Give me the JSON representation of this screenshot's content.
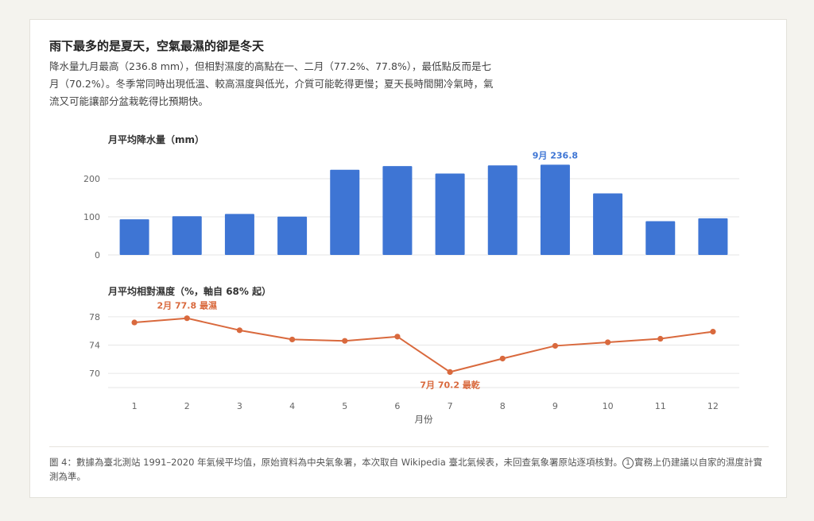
{
  "heading": "雨下最多的是夏天，空氣最濕的卻是冬天",
  "description": "降水量九月最高（236.8 mm），但相對濕度的高點在一、二月（77.2%、77.8%），最低點反而是七月（70.2%）。冬季常同時出現低溫、較高濕度與低光，介質可能乾得更慢；夏天長時間開冷氣時，氣流又可能讓部分盆栽乾得比預期快。",
  "footnote": {
    "text": "圖 4：數據為臺北測站 1991–2020 年氣候平均值，原始資料為中央氣象署，本次取自 Wikipedia 臺北氣候表，未回查氣象署原站逐項核對。",
    "marker": "1",
    "note": "實務上仍建議以自家的濕度計實測為準。"
  },
  "colors": {
    "bar": "#3e75d4",
    "line": "#d9693d",
    "grid": "#e6e6e6"
  },
  "chart_data": [
    {
      "type": "bar",
      "title": "月平均降水量（mm）",
      "categories": [
        "1",
        "2",
        "3",
        "4",
        "5",
        "6",
        "7",
        "8",
        "9",
        "10",
        "11",
        "12"
      ],
      "values": [
        93.5,
        101.5,
        107.5,
        100.5,
        223.5,
        233,
        213.5,
        235,
        236.8,
        161.5,
        88.5,
        96
      ],
      "ylim": [
        0,
        250
      ],
      "yticks": [
        0,
        100,
        200
      ],
      "grid": true,
      "annotations": [
        {
          "index": 8,
          "text": "9月 236.8",
          "position": "above"
        }
      ]
    },
    {
      "type": "line",
      "title": "月平均相對濕度（%，軸自 68% 起）",
      "x": [
        "1",
        "2",
        "3",
        "4",
        "5",
        "6",
        "7",
        "8",
        "9",
        "10",
        "11",
        "12"
      ],
      "values": [
        77.2,
        77.8,
        76.1,
        74.8,
        74.6,
        75.2,
        70.2,
        72.1,
        73.9,
        74.4,
        74.9,
        75.9
      ],
      "ylim": [
        68,
        79
      ],
      "yticks": [
        70,
        74,
        78
      ],
      "xlabel": "月份",
      "grid": true,
      "annotations": [
        {
          "index": 1,
          "text": "2月 77.8 最濕",
          "position": "above"
        },
        {
          "index": 6,
          "text": "7月 70.2 最乾",
          "position": "below"
        }
      ]
    }
  ]
}
